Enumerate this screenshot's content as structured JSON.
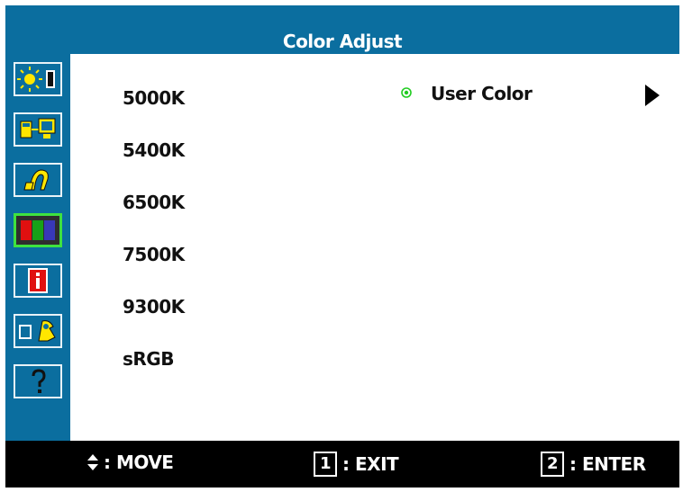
{
  "window": {
    "title": "Color Adjust"
  },
  "sidebar": {
    "items": [
      {
        "icon": "brightness-contrast-icon",
        "selected": false
      },
      {
        "icon": "input-select-icon",
        "selected": false
      },
      {
        "icon": "audio-adjust-icon",
        "selected": false
      },
      {
        "icon": "color-adjust-icon",
        "selected": true
      },
      {
        "icon": "information-icon",
        "selected": false
      },
      {
        "icon": "manual-image-adjust-icon",
        "selected": false
      },
      {
        "icon": "help-icon",
        "selected": false
      }
    ]
  },
  "options": [
    "5000K",
    "5400K",
    "6500K",
    "7500K",
    "9300K",
    "sRGB"
  ],
  "user_color": {
    "label": "User Color",
    "selected": true
  },
  "footer": {
    "move_label": ": MOVE",
    "exit_key": "1",
    "exit_label": ": EXIT",
    "enter_key": "2",
    "enter_label": ": ENTER"
  },
  "colors": {
    "osd_blue": "#0b6e9f",
    "selection_green": "#3fe23f",
    "radio_green": "#22cc22"
  }
}
